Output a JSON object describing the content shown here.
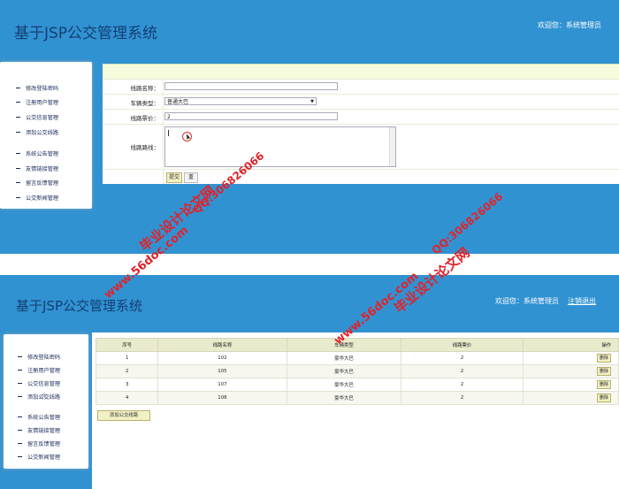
{
  "app": {
    "title": "基于JSP公交管理系统",
    "welcome": "欢迎您：系统管理员",
    "logout": "注销退出"
  },
  "sidebar": {
    "items": [
      {
        "label": "修改登陆密码"
      },
      {
        "label": "注册用户管理"
      },
      {
        "label": "公交信息管理"
      },
      {
        "label": "添加公交线路"
      },
      {
        "label": "系统公告管理"
      },
      {
        "label": "友情链接管理"
      },
      {
        "label": "留言反馈管理"
      },
      {
        "label": "公交新闻管理"
      }
    ]
  },
  "form": {
    "route_name_label": "线路名称：",
    "route_name_value": "",
    "vehicle_type_label": "车辆类型：",
    "vehicle_type_value": "普通大巴",
    "price_label": "线路票价：",
    "price_value": "2",
    "route_path_label": "线路路线：",
    "submit_label": "提交",
    "reset_label": "重"
  },
  "table": {
    "columns": [
      "序号",
      "线路名称",
      "车辆类型",
      "线路票价",
      "操作"
    ],
    "rows": [
      [
        "1",
        "102",
        "豪华大巴",
        "2",
        "删除"
      ],
      [
        "2",
        "105",
        "豪华大巴",
        "2",
        "删除"
      ],
      [
        "3",
        "107",
        "豪华大巴",
        "2",
        "删除"
      ],
      [
        "4",
        "108",
        "豪华大巴",
        "2",
        "删除"
      ]
    ],
    "add_label": "添加公交线路"
  },
  "watermark": {
    "site": "www.56doc.com",
    "qq": "QQ:306826066",
    "name": "毕业设计论文网"
  },
  "colors": {
    "header_blue": "#3192d2",
    "brand_text": "#133f73",
    "button_bg": "#f2f0c4",
    "watermark_red": "#e0232a"
  }
}
